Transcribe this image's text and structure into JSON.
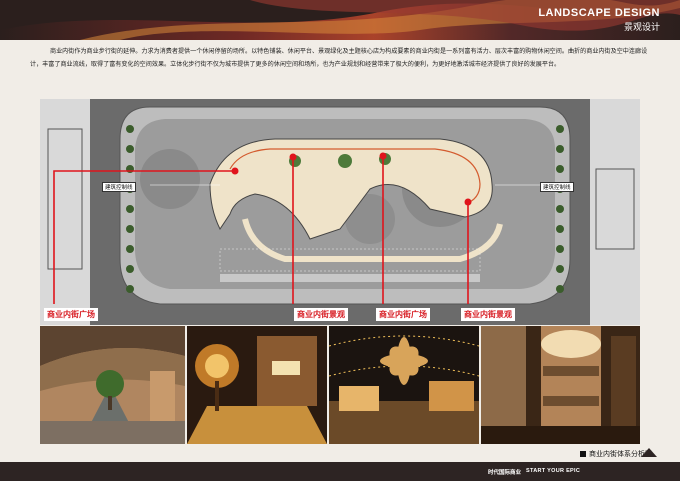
{
  "header": {
    "title_en": "LANDSCAPE DESIGN",
    "title_cn": "景观设计"
  },
  "intro": {
    "text": "商业内街作为商业步行街的延伸。力求为消费者提供一个休闲停留的场所。以特色铺装、休闲平台、景观绿化及主题核心店为构成要素的商业内街是一系列富有活力、层次丰富的购物休闲空间。曲折的商业内街及空中连廊设计，丰富了商业流线，取得了富有变化的空间效果。立体化步行街不仅为城市提供了更多的休闲空间和场所，也为产业规划和经营带来了极大的便利，为更好地激活城市经济提供了良好的发展平台。"
  },
  "plan": {
    "boundary_labels": [
      "建筑控制线",
      "建筑控制线"
    ],
    "captions": [
      "商业内街广场",
      "商业内街景观",
      "商业内街广场",
      "商业内街景观"
    ],
    "accent_color": "#e0141c"
  },
  "photos": {
    "items": [
      {
        "icon": "atrium-photo"
      },
      {
        "icon": "night-street-photo"
      },
      {
        "icon": "palm-plaza-photo"
      },
      {
        "icon": "interior-mall-photo"
      }
    ]
  },
  "footer": {
    "section_title": "商业内街体系分析图",
    "tag": "时代国际商业",
    "slogan": "START YOUR EPIC"
  }
}
